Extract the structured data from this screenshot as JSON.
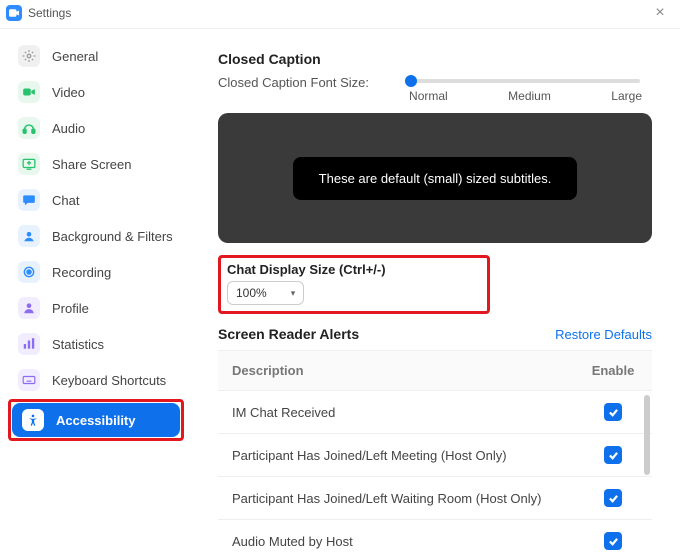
{
  "titlebar": {
    "title": "Settings"
  },
  "sidebar": {
    "items": [
      {
        "label": "General"
      },
      {
        "label": "Video"
      },
      {
        "label": "Audio"
      },
      {
        "label": "Share Screen"
      },
      {
        "label": "Chat"
      },
      {
        "label": "Background & Filters"
      },
      {
        "label": "Recording"
      },
      {
        "label": "Profile"
      },
      {
        "label": "Statistics"
      },
      {
        "label": "Keyboard Shortcuts"
      },
      {
        "label": "Accessibility"
      }
    ]
  },
  "closedCaption": {
    "heading": "Closed Caption",
    "fontSizeLabel": "Closed Caption Font Size:",
    "ticks": {
      "a": "Normal",
      "b": "Medium",
      "c": "Large"
    },
    "previewText": "These are default (small) sized subtitles."
  },
  "chatDisplay": {
    "heading": "Chat Display Size (Ctrl+/-)",
    "value": "100%"
  },
  "screenReader": {
    "heading": "Screen Reader Alerts",
    "restore": "Restore Defaults",
    "colDesc": "Description",
    "colEnable": "Enable",
    "rows": [
      {
        "desc": "IM Chat Received"
      },
      {
        "desc": "Participant Has Joined/Left Meeting (Host Only)"
      },
      {
        "desc": "Participant Has Joined/Left Waiting Room (Host Only)"
      },
      {
        "desc": "Audio Muted by Host"
      }
    ]
  },
  "colors": {
    "accent": "#0E71EB",
    "highlight": "#E1191E"
  }
}
